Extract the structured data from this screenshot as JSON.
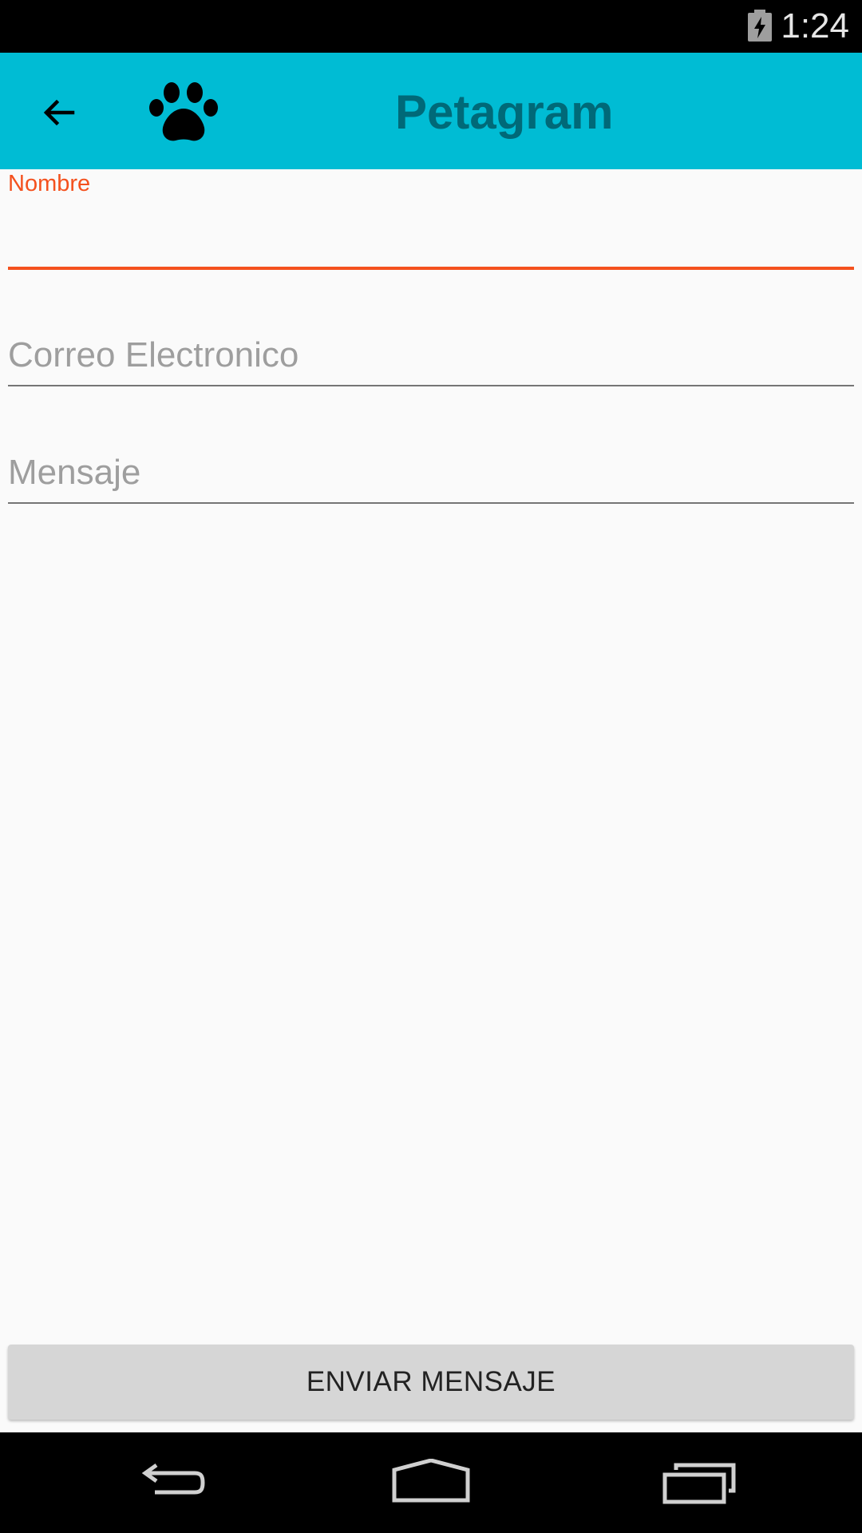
{
  "status_bar": {
    "time": "1:24",
    "battery_icon": "battery-charging-icon"
  },
  "toolbar": {
    "title": "Petagram",
    "back_icon": "arrow-left-icon",
    "logo_icon": "paw-print-icon",
    "background_color": "#00bcd4",
    "title_color": "#006978"
  },
  "form": {
    "name": {
      "label": "Nombre",
      "value": "",
      "accent_color": "#f4511e"
    },
    "email": {
      "placeholder": "Correo Electronico",
      "value": ""
    },
    "message": {
      "placeholder": "Mensaje",
      "value": ""
    }
  },
  "send_button": {
    "label": "ENVIAR MENSAJE"
  },
  "nav_bar": {
    "back_icon": "nav-back-icon",
    "home_icon": "nav-home-icon",
    "recents_icon": "nav-recents-icon"
  }
}
